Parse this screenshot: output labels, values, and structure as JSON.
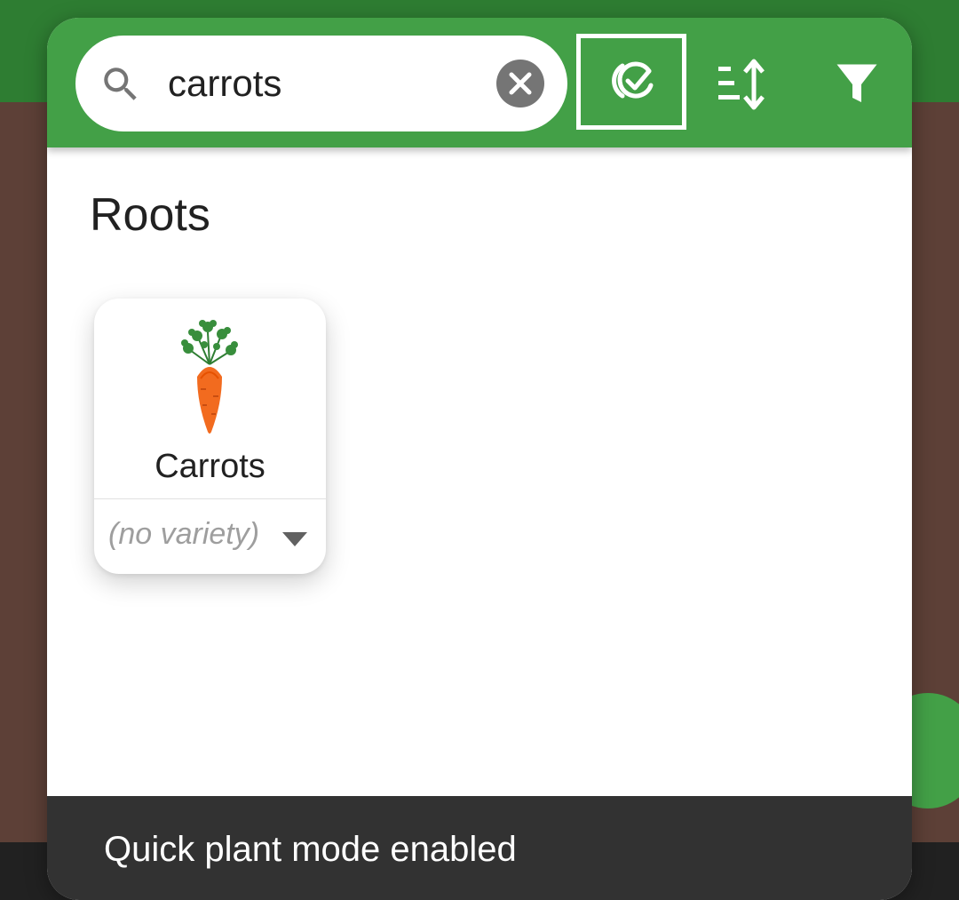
{
  "search": {
    "value": "carrots",
    "placeholder": ""
  },
  "toolbar": {
    "icons": [
      "search-icon",
      "clear-icon",
      "quick-plant-icon",
      "sort-icon",
      "filter-icon"
    ]
  },
  "section": {
    "title": "Roots"
  },
  "plants": [
    {
      "name": "Carrots",
      "variety": "(no variety)",
      "icon": "carrot-icon"
    }
  ],
  "snackbar": {
    "message": "Quick plant mode enabled"
  },
  "colors": {
    "header": "#43a047",
    "snackbar": "#323232",
    "background": "#5d4037"
  }
}
